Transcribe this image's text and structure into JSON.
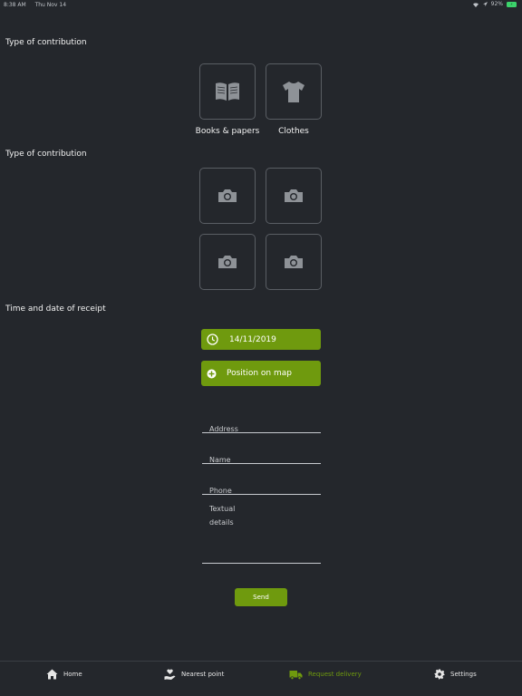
{
  "status_bar": {
    "time": "8:38 AM",
    "date": "Thu Nov 14",
    "battery": "92%"
  },
  "sections": {
    "contribution_type_label": "Type of contribution",
    "photos_label": "Type of contribution",
    "time_date_label": "Time and date of receipt"
  },
  "contribution_types": [
    {
      "label": "Books & papers",
      "icon": "book-icon"
    },
    {
      "label": "Clothes",
      "icon": "tshirt-icon"
    }
  ],
  "photo_slots": [
    "camera-icon",
    "camera-icon",
    "camera-icon",
    "camera-icon"
  ],
  "date_button": {
    "value": "14/11/2019",
    "icon": "clock-icon"
  },
  "position_button": {
    "label": "Position on map",
    "icon": "crosshair-icon"
  },
  "form": {
    "address_placeholder": "Address",
    "name_placeholder": "Name",
    "phone_placeholder": "Phone",
    "details_placeholder": "Textual\ndetails"
  },
  "send_label": "Send",
  "tabs": [
    {
      "label": "Home",
      "icon": "home-icon"
    },
    {
      "label": "Nearest point",
      "icon": "heart-hand-icon"
    },
    {
      "label": "Request delivery",
      "icon": "truck-icon",
      "active": true
    },
    {
      "label": "Settings",
      "icon": "gear-icon"
    }
  ],
  "colors": {
    "background": "#24272c",
    "accent": "#6f9a0e",
    "tile_border": "#5a5e64"
  }
}
